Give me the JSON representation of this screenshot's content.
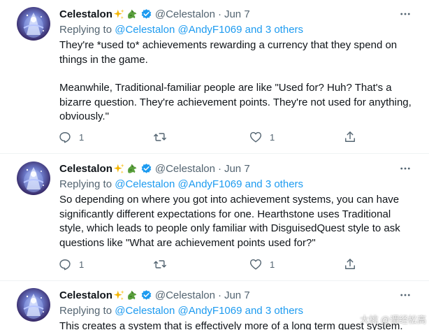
{
  "colors": {
    "link": "#1d9bf0",
    "verified": "#1d9bf0",
    "secondary_text": "#536471",
    "primary_text": "#0f1419",
    "divider": "#eff3f4"
  },
  "tweets": [
    {
      "author": {
        "name": "Celestalon",
        "name_emojis": [
          "sparkles-emoji",
          "dragon-emoji"
        ],
        "handle": "@Celestalon",
        "verified": true
      },
      "dot": "·",
      "date": "Jun 7",
      "replying": {
        "prefix": "Replying to",
        "user1": "@Celestalon",
        "user2": "@AndyF1069",
        "connector": "and",
        "others": "3 others"
      },
      "paragraphs": [
        "They're *used to* achievements rewarding a currency that they spend on things in the game.",
        "Meanwhile, Traditional-familiar people are like \"Used for? Huh? That's a bizarre question. They're achievement points. They're not used for anything, obviously.\""
      ],
      "actions": {
        "reply_count": "1",
        "retweet_count": "",
        "like_count": "1"
      }
    },
    {
      "author": {
        "name": "Celestalon",
        "name_emojis": [
          "sparkles-emoji",
          "dragon-emoji"
        ],
        "handle": "@Celestalon",
        "verified": true
      },
      "dot": "·",
      "date": "Jun 7",
      "replying": {
        "prefix": "Replying to",
        "user1": "@Celestalon",
        "user2": "@AndyF1069",
        "connector": "and",
        "others": "3 others"
      },
      "paragraphs": [
        "So depending on where you got into achievement systems, you can have significantly different expectations for one. Hearthstone uses Traditional style, which leads to people only familiar with DisguisedQuest style to ask questions like \"What are achievement points used for?\""
      ],
      "actions": {
        "reply_count": "1",
        "retweet_count": "",
        "like_count": "1"
      }
    },
    {
      "author": {
        "name": "Celestalon",
        "name_emojis": [
          "sparkles-emoji",
          "dragon-emoji"
        ],
        "handle": "@Celestalon",
        "verified": true
      },
      "dot": "·",
      "date": "Jun 7",
      "replying": {
        "prefix": "Replying to",
        "user1": "@Celestalon",
        "user2": "@AndyF1069",
        "connector": "and",
        "others": "3 others"
      },
      "paragraphs": [
        "This creates a system that is effectively more of a long term quest system."
      ]
    }
  ],
  "watermark": "大桃 @谓经松高"
}
